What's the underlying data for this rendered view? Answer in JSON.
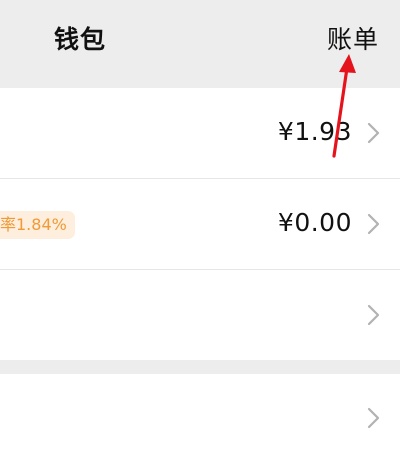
{
  "header": {
    "title": "钱包",
    "bill_label": "账单"
  },
  "rows": [
    {
      "amount": "¥1.93"
    },
    {
      "badge": "率1.84%",
      "amount": "¥0.00"
    },
    {
      "amount": ""
    }
  ],
  "icons": {
    "chevron": "chevron-right-icon",
    "annotation": "red-arrow-annotation"
  },
  "colors": {
    "background": "#ededed",
    "card": "#ffffff",
    "badge_bg": "#fdeedd",
    "badge_text": "#f19a36",
    "annotation": "#e5141c"
  }
}
